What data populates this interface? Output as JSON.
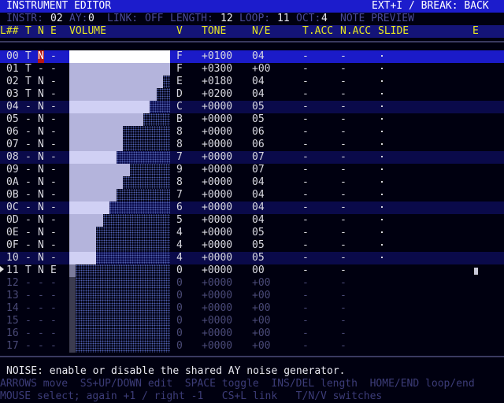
{
  "title": {
    "left": "INSTRUMENT EDITOR",
    "right": "EXT+I / BREAK: BACK"
  },
  "info": {
    "instr_label": "INSTR:",
    "instr": "02",
    "ay_label": "AY:",
    "ay": "0",
    "link_label": "LINK:",
    "link": "OFF",
    "length_label": "LENGTH:",
    "length": "12",
    "loop_label": "LOOP:",
    "loop": "11",
    "oct_label": "OCT:",
    "oct": "4",
    "preview": "NOTE PREVIEW"
  },
  "columns": {
    "line": "L##",
    "t": "T",
    "n": "N",
    "e": "E",
    "volume": "VOLUME",
    "v": "V",
    "tone": "TONE",
    "ne": "N/E",
    "tacc": "T.ACC",
    "nacc": "N.ACC",
    "slide": "SLIDE",
    "end": "E"
  },
  "rows": [
    {
      "l": "00",
      "t": "T",
      "n": "N",
      "e": "-",
      "v": "F",
      "tone": "+0100",
      "ne": "04",
      "tacc": "-",
      "nacc": "-",
      "vol": 15,
      "state": "sel"
    },
    {
      "l": "01",
      "t": "T",
      "n": "-",
      "e": "-",
      "v": "F",
      "tone": "+0300",
      "ne": "+00",
      "tacc": "-",
      "nacc": "-",
      "vol": 15,
      "state": ""
    },
    {
      "l": "02",
      "t": "T",
      "n": "N",
      "e": "-",
      "v": "E",
      "tone": "+0180",
      "ne": "04",
      "tacc": "-",
      "nacc": "-",
      "vol": 14,
      "state": ""
    },
    {
      "l": "03",
      "t": "T",
      "n": "N",
      "e": "-",
      "v": "D",
      "tone": "+0200",
      "ne": "04",
      "tacc": "-",
      "nacc": "-",
      "vol": 13,
      "state": ""
    },
    {
      "l": "04",
      "t": "-",
      "n": "N",
      "e": "-",
      "v": "C",
      "tone": "+0000",
      "ne": "05",
      "tacc": "-",
      "nacc": "-",
      "vol": 12,
      "state": "alt"
    },
    {
      "l": "05",
      "t": "-",
      "n": "N",
      "e": "-",
      "v": "B",
      "tone": "+0000",
      "ne": "05",
      "tacc": "-",
      "nacc": "-",
      "vol": 11,
      "state": ""
    },
    {
      "l": "06",
      "t": "-",
      "n": "N",
      "e": "-",
      "v": "8",
      "tone": "+0000",
      "ne": "06",
      "tacc": "-",
      "nacc": "-",
      "vol": 8,
      "state": ""
    },
    {
      "l": "07",
      "t": "-",
      "n": "N",
      "e": "-",
      "v": "8",
      "tone": "+0000",
      "ne": "06",
      "tacc": "-",
      "nacc": "-",
      "vol": 8,
      "state": ""
    },
    {
      "l": "08",
      "t": "-",
      "n": "N",
      "e": "-",
      "v": "7",
      "tone": "+0000",
      "ne": "07",
      "tacc": "-",
      "nacc": "-",
      "vol": 7,
      "state": "alt"
    },
    {
      "l": "09",
      "t": "-",
      "n": "N",
      "e": "-",
      "v": "9",
      "tone": "+0000",
      "ne": "07",
      "tacc": "-",
      "nacc": "-",
      "vol": 9,
      "state": ""
    },
    {
      "l": "0A",
      "t": "-",
      "n": "N",
      "e": "-",
      "v": "8",
      "tone": "+0000",
      "ne": "04",
      "tacc": "-",
      "nacc": "-",
      "vol": 8,
      "state": ""
    },
    {
      "l": "0B",
      "t": "-",
      "n": "N",
      "e": "-",
      "v": "7",
      "tone": "+0000",
      "ne": "04",
      "tacc": "-",
      "nacc": "-",
      "vol": 7,
      "state": ""
    },
    {
      "l": "0C",
      "t": "-",
      "n": "N",
      "e": "-",
      "v": "6",
      "tone": "+0000",
      "ne": "04",
      "tacc": "-",
      "nacc": "-",
      "vol": 6,
      "state": "alt"
    },
    {
      "l": "0D",
      "t": "-",
      "n": "N",
      "e": "-",
      "v": "5",
      "tone": "+0000",
      "ne": "04",
      "tacc": "-",
      "nacc": "-",
      "vol": 5,
      "state": ""
    },
    {
      "l": "0E",
      "t": "-",
      "n": "N",
      "e": "-",
      "v": "4",
      "tone": "+0000",
      "ne": "05",
      "tacc": "-",
      "nacc": "-",
      "vol": 4,
      "state": ""
    },
    {
      "l": "0F",
      "t": "-",
      "n": "N",
      "e": "-",
      "v": "4",
      "tone": "+0000",
      "ne": "05",
      "tacc": "-",
      "nacc": "-",
      "vol": 4,
      "state": ""
    },
    {
      "l": "10",
      "t": "-",
      "n": "N",
      "e": "-",
      "v": "4",
      "tone": "+0000",
      "ne": "05",
      "tacc": "-",
      "nacc": "-",
      "vol": 4,
      "state": "alt"
    },
    {
      "l": "11",
      "t": "T",
      "n": "N",
      "e": "E",
      "v": "0",
      "tone": "+0000",
      "ne": "00",
      "tacc": "-",
      "nacc": "-",
      "vol": 0,
      "state": "end"
    },
    {
      "l": "12",
      "t": "-",
      "n": "-",
      "e": "-",
      "v": "0",
      "tone": "+0000",
      "ne": "+00",
      "tacc": "-",
      "nacc": "-",
      "vol": 0,
      "state": "blank"
    },
    {
      "l": "13",
      "t": "-",
      "n": "-",
      "e": "-",
      "v": "0",
      "tone": "+0000",
      "ne": "+00",
      "tacc": "-",
      "nacc": "-",
      "vol": 0,
      "state": "blank"
    },
    {
      "l": "14",
      "t": "-",
      "n": "-",
      "e": "-",
      "v": "0",
      "tone": "+0000",
      "ne": "+00",
      "tacc": "-",
      "nacc": "-",
      "vol": 0,
      "state": "blank"
    },
    {
      "l": "15",
      "t": "-",
      "n": "-",
      "e": "-",
      "v": "0",
      "tone": "+0000",
      "ne": "+00",
      "tacc": "-",
      "nacc": "-",
      "vol": 0,
      "state": "blank"
    },
    {
      "l": "16",
      "t": "-",
      "n": "-",
      "e": "-",
      "v": "0",
      "tone": "+0000",
      "ne": "+00",
      "tacc": "-",
      "nacc": "-",
      "vol": 0,
      "state": "blank"
    },
    {
      "l": "17",
      "t": "-",
      "n": "-",
      "e": "-",
      "v": "0",
      "tone": "+0000",
      "ne": "+00",
      "tacc": "-",
      "nacc": "-",
      "vol": 0,
      "state": "blank"
    }
  ],
  "hint": "NOISE: enable or disable the shared AY noise generator.",
  "keys1": "ARROWS move  SS+UP/DOWN edit  SPACE toggle  INS/DEL length  HOME/END loop/end",
  "keys2": "MOUSE select; again +1 / right -1   CS+L link   T/N/V switches",
  "colors": {
    "title_bg": "#1c1ccc",
    "header_fg": "#e8e820",
    "cursor_bg": "#b81818",
    "vol_light": "#b4b4dc",
    "vol_bright": "#ffffff"
  }
}
